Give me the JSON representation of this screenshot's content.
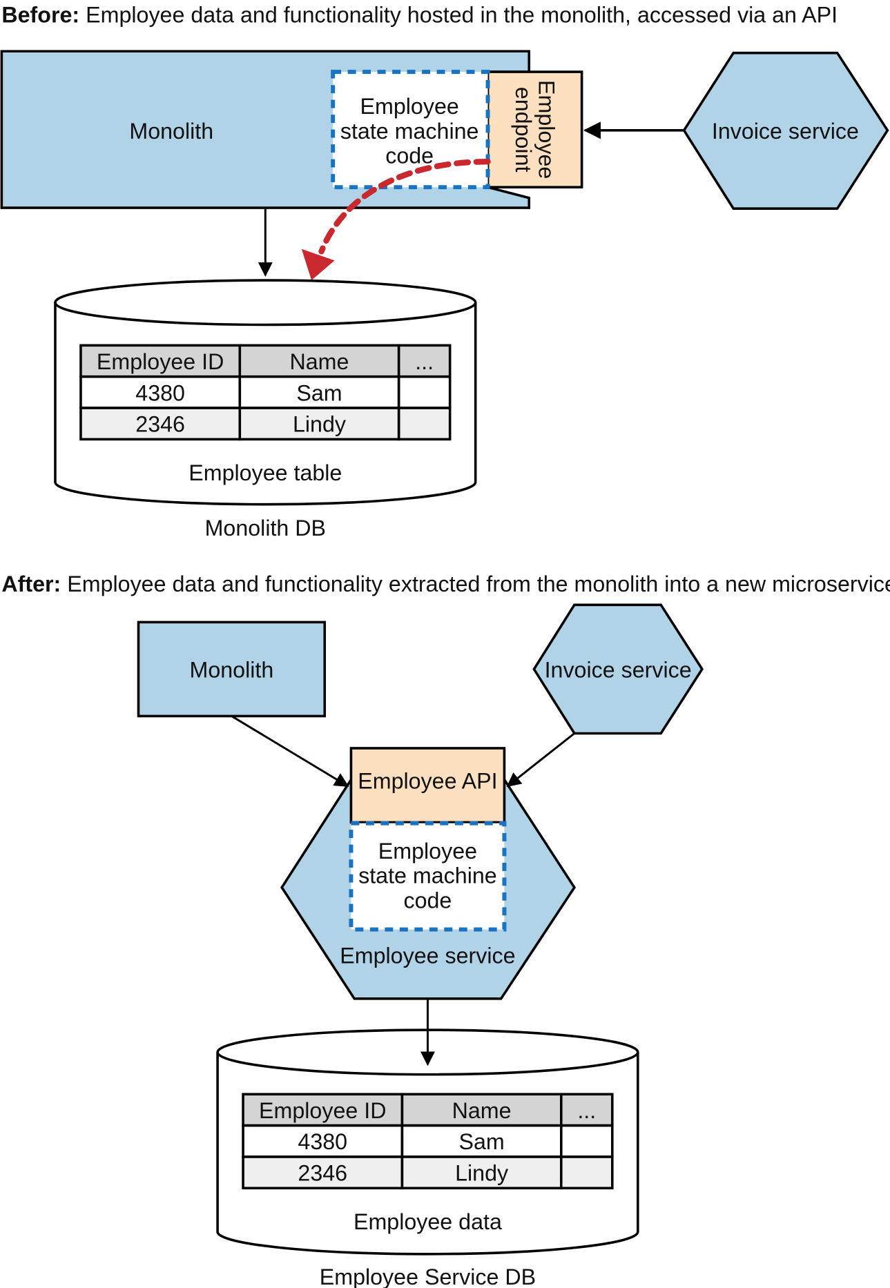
{
  "before": {
    "title_bold": "Before:",
    "title_rest": " Employee data and functionality hosted in the monolith, accessed via an API",
    "monolith": "Monolith",
    "state_machine": [
      "Employee",
      "state machine",
      "code"
    ],
    "endpoint": [
      "Employee",
      "endpoint"
    ],
    "invoice": "Invoice service",
    "table": {
      "headers": [
        "Employee ID",
        "Name",
        "..."
      ],
      "rows": [
        [
          "4380",
          "Sam",
          ""
        ],
        [
          "2346",
          "Lindy",
          ""
        ]
      ]
    },
    "table_label": "Employee table",
    "db_label": "Monolith DB"
  },
  "after": {
    "title_bold": "After:",
    "title_rest": " Employee data and functionality extracted from the monolith into a new microservice",
    "monolith": "Monolith",
    "invoice": "Invoice service",
    "api": "Employee API",
    "state_machine": [
      "Employee",
      "state machine",
      "code"
    ],
    "service": "Employee service",
    "table": {
      "headers": [
        "Employee ID",
        "Name",
        "..."
      ],
      "rows": [
        [
          "4380",
          "Sam",
          ""
        ],
        [
          "2346",
          "Lindy",
          ""
        ]
      ]
    },
    "table_label": "Employee data",
    "db_label": "Employee Service DB"
  },
  "colors": {
    "service_blue": "#b0d3e8",
    "api_peach": "#fde0bf",
    "dash_blue": "#1a73c0",
    "migration_red": "#c8282e"
  }
}
